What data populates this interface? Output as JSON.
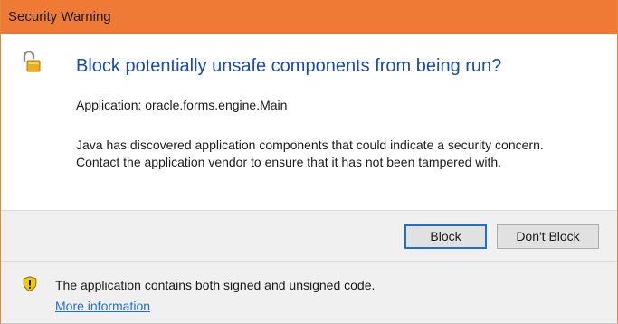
{
  "window": {
    "title": "Security Warning"
  },
  "dialog": {
    "heading": "Block potentially unsafe components from being run?",
    "application_line": "Application: oracle.forms.engine.Main",
    "description": "Java has discovered application components that could indicate a security concern. Contact the application vendor to ensure that it has not been tampered with."
  },
  "buttons": {
    "block_label": "Block",
    "dont_block_label": "Don't Block"
  },
  "footer": {
    "info_text": "The application contains both signed and unsigned code.",
    "more_info_link": "More information"
  },
  "icons": {
    "title_icon": "unlocked-padlock-icon",
    "footer_icon": "warning-shield-icon"
  },
  "colors": {
    "titlebar": "#ee7a36",
    "heading": "#1a4aa8",
    "link": "#1e6fd2",
    "focus_border": "#1e6fd2",
    "panel": "#f0f0f0"
  }
}
